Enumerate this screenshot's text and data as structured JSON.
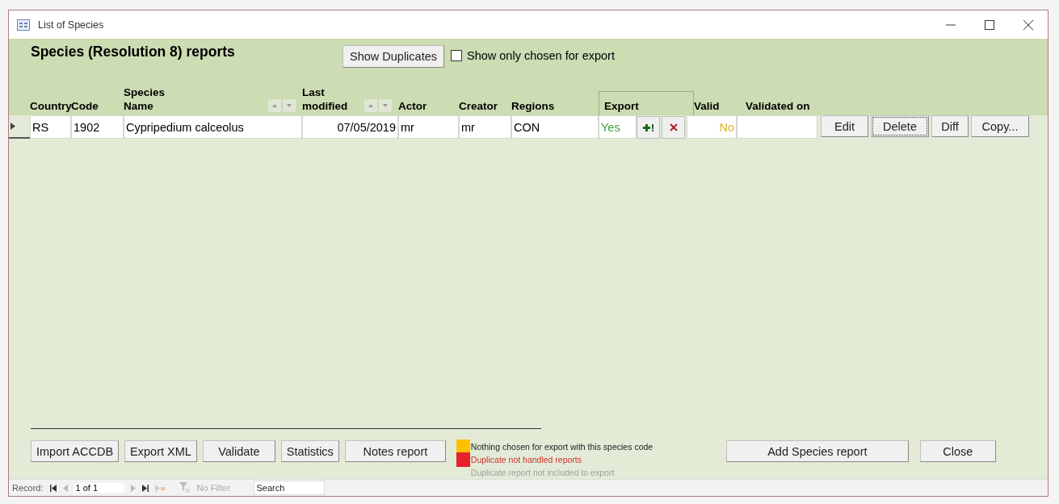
{
  "window": {
    "title": "List of Species"
  },
  "header": {
    "title": "Species (Resolution 8) reports",
    "show_duplicates": "Show Duplicates",
    "only_chosen": {
      "label": "Show only chosen for export",
      "checked": false
    }
  },
  "columns": [
    {
      "kind": "plain",
      "label": "Country"
    },
    {
      "kind": "plain",
      "label": "Code"
    },
    {
      "kind": "sortable",
      "label": "Species\nName"
    },
    {
      "kind": "sortable",
      "label": "Last\nmodified"
    },
    {
      "kind": "plain",
      "label": "Actor"
    },
    {
      "kind": "plain",
      "label": "Creator"
    },
    {
      "kind": "plain",
      "label": "Regions"
    },
    {
      "kind": "framed",
      "label": "Export"
    },
    {
      "kind": "plain",
      "label": "Valid"
    },
    {
      "kind": "plain",
      "label": "Validated on"
    }
  ],
  "rows": [
    {
      "current": true,
      "country": "RS",
      "code": "1902",
      "name": "Cypripedium calceolus",
      "modified": "07/05/2019",
      "actor": "mr",
      "creator": "mr",
      "regions": "CON",
      "export": {
        "value": "Yes",
        "on": true
      },
      "valid": {
        "value": "No",
        "on": false
      },
      "buttons": [
        {
          "label": "Edit",
          "focused": false
        },
        {
          "label": "Delete",
          "focused": true
        },
        {
          "label": "Diff",
          "focused": false
        },
        {
          "label": "Copy...",
          "focused": false
        }
      ]
    }
  ],
  "bottom_buttons": [
    "Import ACCDB",
    "Export XML",
    "Validate",
    "Statistics",
    "Notes report"
  ],
  "legend": [
    {
      "kind": "warning",
      "text": "Nothing chosen for export with this species  code",
      "color": "#ffc000"
    },
    {
      "kind": "error",
      "text": "Duplicate not handled reports",
      "color": "#e8202a"
    },
    {
      "kind": "note",
      "text": "Duplicate report not included to export"
    }
  ],
  "right_buttons": [
    "Add Species report",
    "Close"
  ],
  "nav": {
    "label": "Record:",
    "position": "1 of 1",
    "filter": "No Filter",
    "search_placeholder": "Search"
  }
}
